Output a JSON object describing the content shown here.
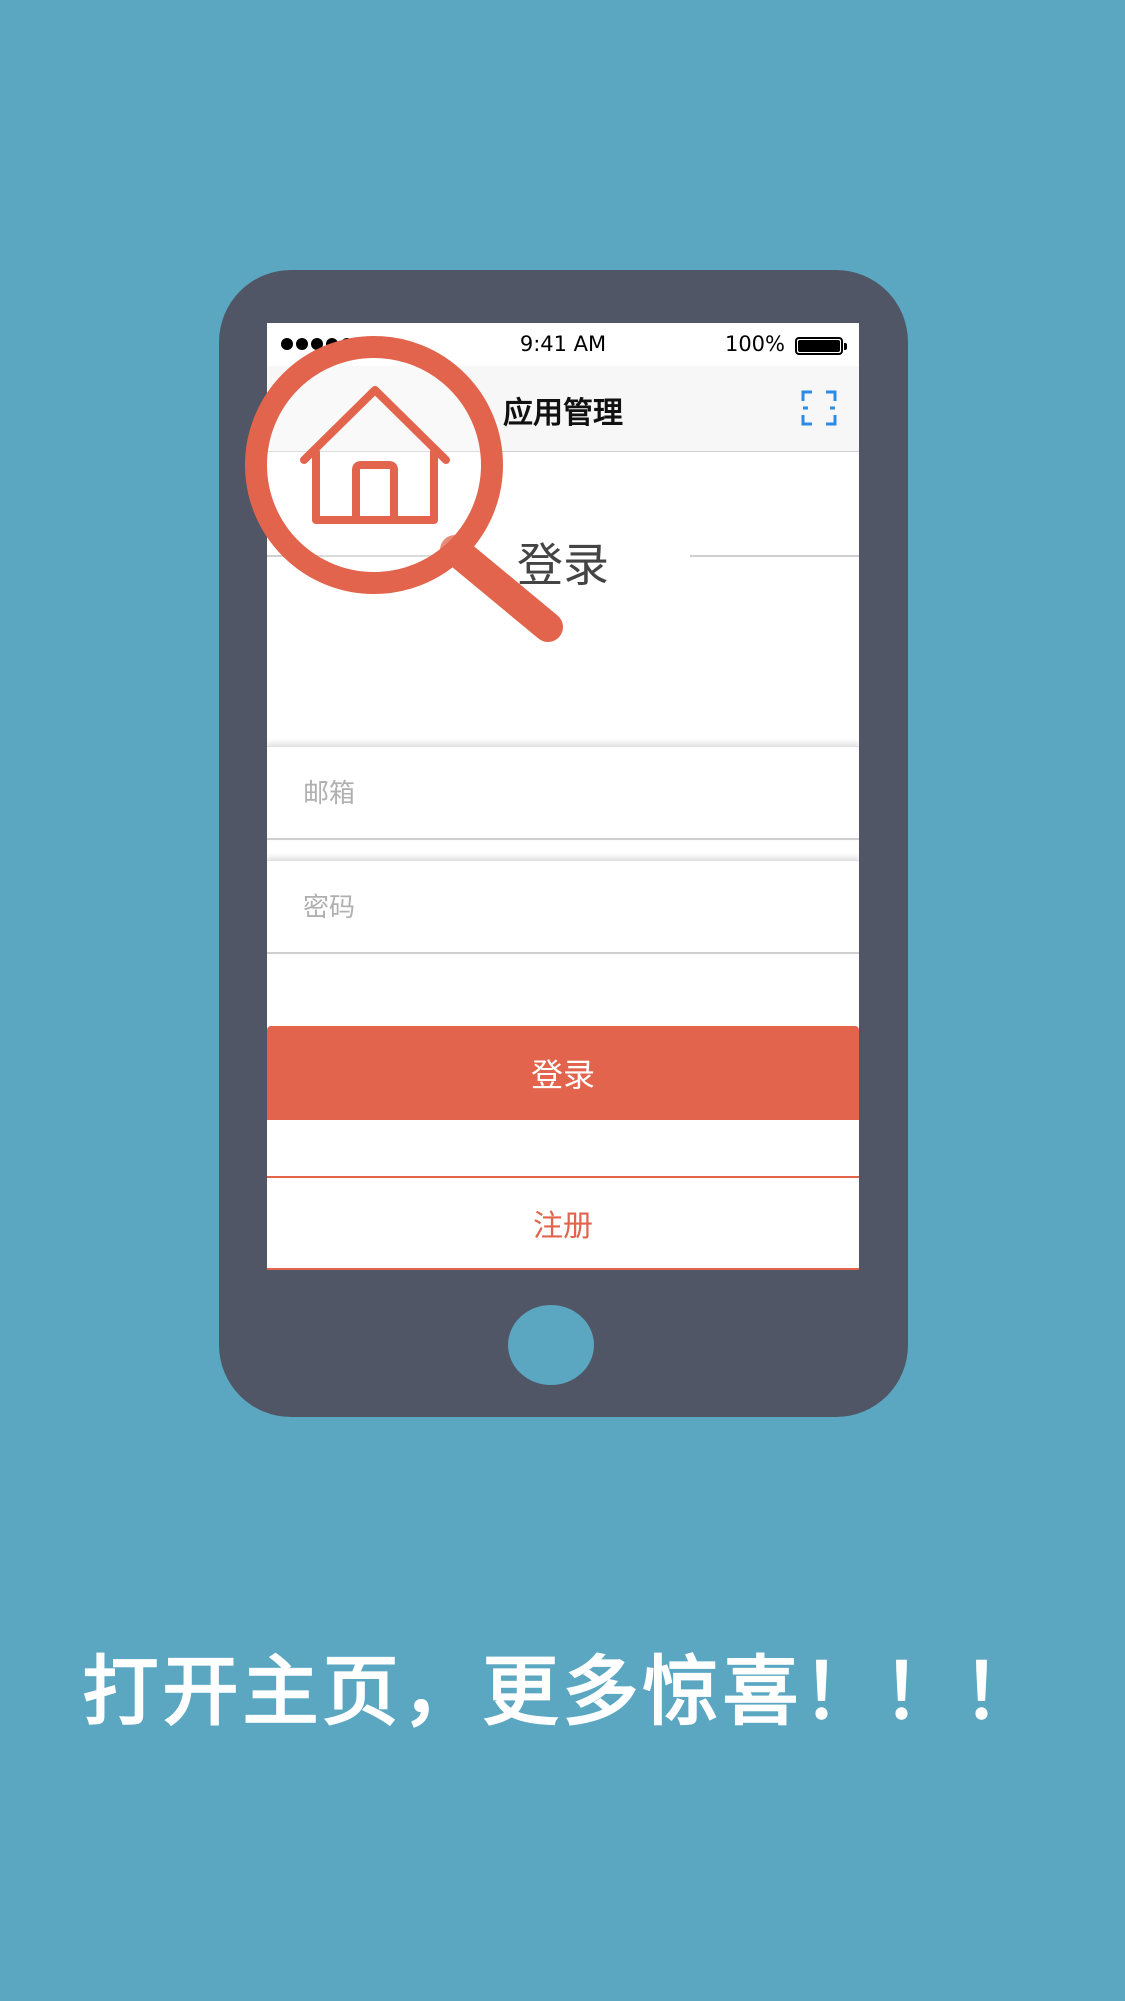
{
  "status_bar": {
    "time": "9:41 AM",
    "battery_percent": "100%",
    "signal_bars": 5
  },
  "nav": {
    "title": "应用管理",
    "right_icon": "scan-icon"
  },
  "login": {
    "heading": "登录",
    "email_placeholder": "邮箱",
    "password_placeholder": "密码",
    "login_button": "登录",
    "register_button": "注册"
  },
  "tagline": "打开主页，更多惊喜！！！",
  "colors": {
    "background": "#5ba7c2",
    "phone": "#505665",
    "accent": "#e2644d",
    "scan_icon": "#2a8be8"
  },
  "overlay_icon": "home-magnifier-icon"
}
